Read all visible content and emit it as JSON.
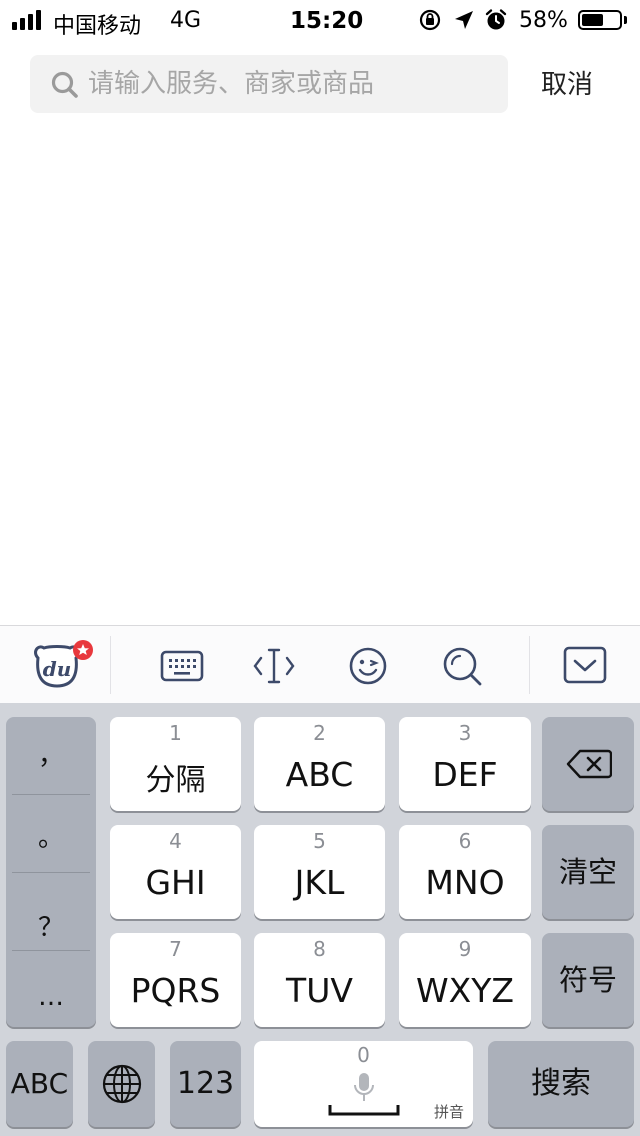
{
  "status_bar": {
    "carrier": "中国移动",
    "network": "4G",
    "time": "15:20",
    "battery_percent": "58%",
    "battery_level": 0.58
  },
  "search": {
    "placeholder": "请输入服务、商家或商品",
    "value": "",
    "cancel_label": "取消"
  },
  "keyboard_toolbar": {
    "logo_text": "du",
    "icons": [
      "du-bear-logo-icon",
      "keyboard-icon",
      "cursor-icon",
      "emoji-icon",
      "search-icon",
      "collapse-keyboard-icon"
    ]
  },
  "keyboard": {
    "punctuation": [
      "，",
      "。",
      "？",
      "…"
    ],
    "keys": [
      {
        "num": "1",
        "label": "分隔"
      },
      {
        "num": "2",
        "label": "ABC"
      },
      {
        "num": "3",
        "label": "DEF"
      },
      {
        "num": "4",
        "label": "GHI"
      },
      {
        "num": "5",
        "label": "JKL"
      },
      {
        "num": "6",
        "label": "MNO"
      },
      {
        "num": "7",
        "label": "PQRS"
      },
      {
        "num": "8",
        "label": "TUV"
      },
      {
        "num": "9",
        "label": "WXYZ"
      }
    ],
    "clear_label": "清空",
    "symbols_label": "符号",
    "abc_label": "ABC",
    "num_switch_label": "123",
    "space_num": "0",
    "pinyin_label": "拼音",
    "search_label": "搜索"
  },
  "colors": {
    "keyboard_bg": "#d1d4da",
    "key_light": "#ffffff",
    "key_dark": "#abb0ba",
    "badge_red": "#e8383d"
  }
}
